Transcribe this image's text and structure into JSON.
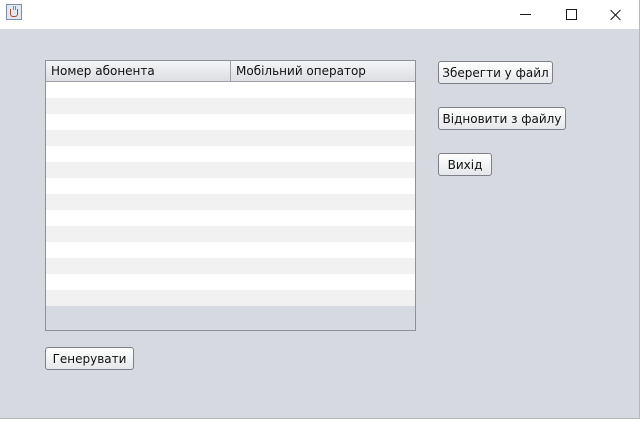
{
  "window": {
    "icon": "java-cup-icon",
    "controls": {
      "minimize_icon": "minimize-icon",
      "maximize_icon": "maximize-icon",
      "close_icon": "close-icon"
    }
  },
  "table": {
    "columns": [
      "Номер абонента",
      "Мобільний оператор"
    ],
    "rows": [
      [
        "",
        ""
      ],
      [
        "",
        ""
      ],
      [
        "",
        ""
      ],
      [
        "",
        ""
      ],
      [
        "",
        ""
      ],
      [
        "",
        ""
      ],
      [
        "",
        ""
      ],
      [
        "",
        ""
      ],
      [
        "",
        ""
      ],
      [
        "",
        ""
      ],
      [
        "",
        ""
      ],
      [
        "",
        ""
      ],
      [
        "",
        ""
      ],
      [
        "",
        ""
      ]
    ]
  },
  "buttons": {
    "save_label": "Зберегти у файл",
    "restore_label": "Відновити з файлу",
    "exit_label": "Вихід",
    "generate_label": "Генерувати"
  },
  "colors": {
    "panel_background": "#d6d9df",
    "row_odd": "#ffffff",
    "row_even": "#f1f1f1"
  }
}
